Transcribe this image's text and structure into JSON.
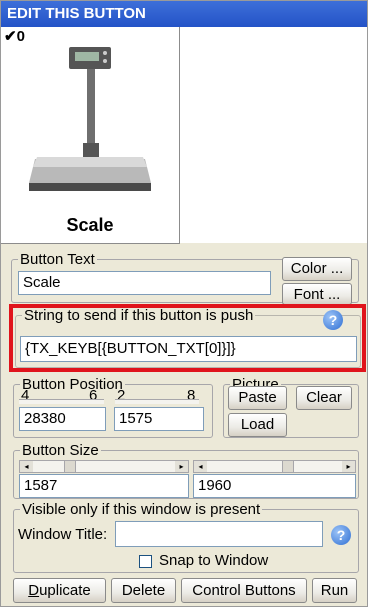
{
  "title": "EDIT THIS BUTTON",
  "preview": {
    "check_label": "✔0",
    "label": "Scale"
  },
  "button_text": {
    "legend": "Button Text",
    "value": "Scale",
    "color_label": "Color ...",
    "font_label": "Font ..."
  },
  "string_send": {
    "legend": "String to send if this button is push",
    "value": "{TX_KEYB[{BUTTON_TXT[0]}]}"
  },
  "position": {
    "legend": "Button Position",
    "d1": "4",
    "d2": "6",
    "d3": "2",
    "d4": "8",
    "x_value": "28380",
    "y_value": "1575"
  },
  "picture": {
    "legend": "Picture",
    "paste_label": "Paste",
    "clear_label": "Clear",
    "load_label": "Load"
  },
  "size": {
    "legend": "Button Size",
    "width_value": "1587",
    "height_value": "1960"
  },
  "visible": {
    "legend": "Visible only if this window is present",
    "window_title_label": "Window Title:",
    "window_title_value": "",
    "snap_label": "Snap to Window"
  },
  "actions": {
    "duplicate": "Duplicate",
    "delete": "Delete",
    "control_buttons": "Control Buttons",
    "run": "Run"
  }
}
